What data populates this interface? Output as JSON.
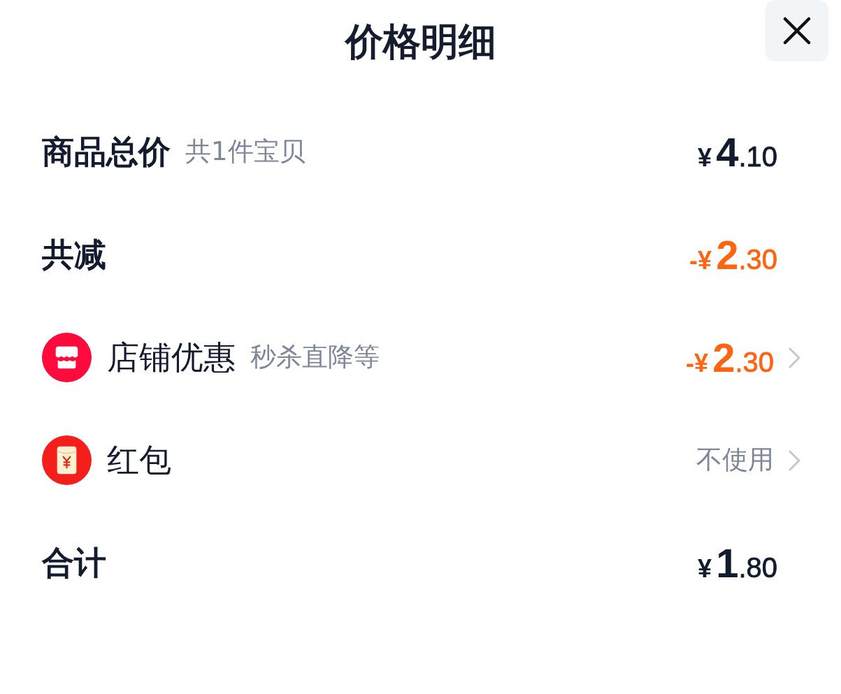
{
  "title": "价格明细",
  "rows": [
    {
      "kind": "summary",
      "label": "商品总价",
      "note": "共1件宝贝",
      "amount": {
        "negative": false,
        "symbol": "¥",
        "whole": "4",
        "fraction": ".10"
      }
    },
    {
      "kind": "summary",
      "label": "共减",
      "amount": {
        "negative": true,
        "symbol": "-¥",
        "whole": "2",
        "fraction": ".30"
      }
    },
    {
      "kind": "store",
      "label": "店铺优惠",
      "note": "秒杀直降等",
      "amount": {
        "negative": true,
        "symbol": "-¥",
        "whole": "2",
        "fraction": ".30"
      }
    },
    {
      "kind": "packet",
      "label": "红包",
      "value": "不使用"
    },
    {
      "kind": "summary",
      "label": "合计",
      "amount": {
        "negative": false,
        "symbol": "¥",
        "whole": "1",
        "fraction": ".80"
      }
    }
  ]
}
